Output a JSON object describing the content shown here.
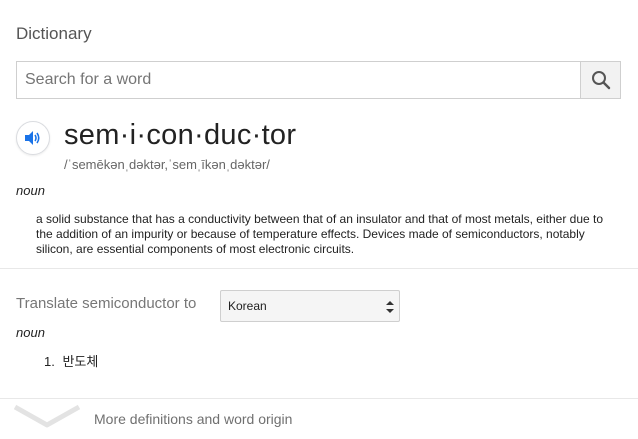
{
  "panel": {
    "title": "Dictionary"
  },
  "search": {
    "placeholder": "Search for a word",
    "value": ""
  },
  "entry": {
    "headword": "sem·i·con·duc·tor",
    "phonetic": "/ˈsemēkənˌdəktər,ˈsemˌīkənˌdəktər/",
    "part_of_speech": "noun",
    "definition": "a solid substance that has a conductivity between that of an insulator and that of most metals, either due to the addition of an impurity or because of temperature effects. Devices made of semiconductors, notably silicon, are essential components of most electronic circuits."
  },
  "translate": {
    "label": "Translate semiconductor to",
    "selected_language": "Korean",
    "part_of_speech": "noun",
    "items": [
      {
        "num": "1.",
        "text": "반도체"
      }
    ]
  },
  "footer": {
    "more_label": "More definitions and word origin"
  },
  "icons": {
    "search": "search-icon",
    "speaker": "speaker-icon",
    "select_arrows": "select-arrows-icon",
    "expand": "chevron-down-icon"
  },
  "colors": {
    "accent": "#1a73e8",
    "muted_text": "#777777"
  }
}
